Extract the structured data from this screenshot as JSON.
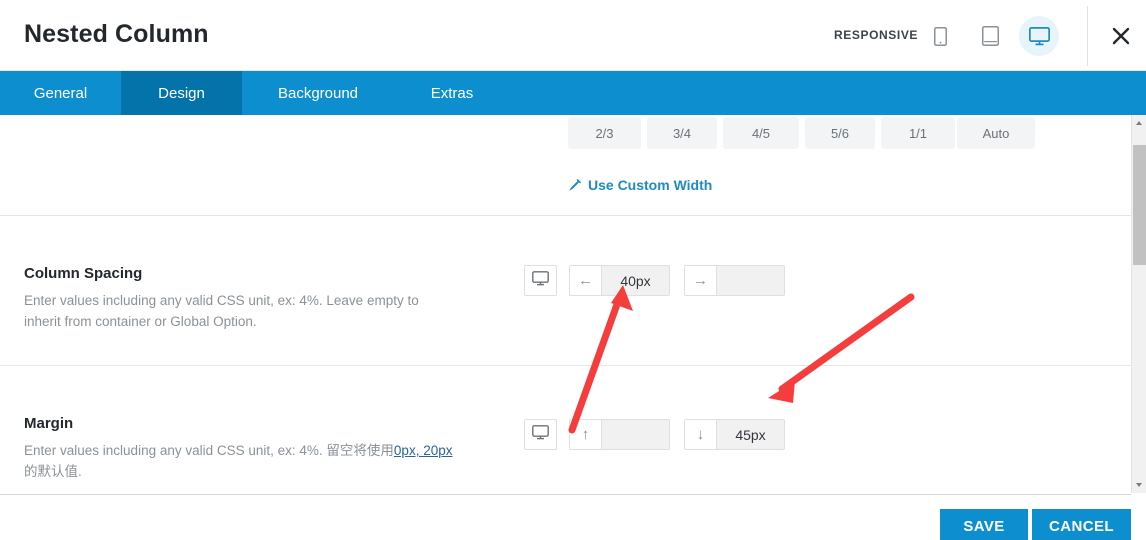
{
  "header": {
    "title": "Nested Column",
    "responsive_label": "RESPONSIVE",
    "devices": [
      {
        "name": "mobile-view-button",
        "icon": "mobile-icon",
        "active": false
      },
      {
        "name": "tablet-view-button",
        "icon": "tablet-icon",
        "active": false
      },
      {
        "name": "desktop-view-button",
        "icon": "desktop-icon",
        "active": true
      }
    ],
    "close_icon": "close-icon"
  },
  "tabs": [
    {
      "label": "General",
      "active": false
    },
    {
      "label": "Design",
      "active": true
    },
    {
      "label": "Background",
      "active": false
    },
    {
      "label": "Extras",
      "active": false
    }
  ],
  "width_presets": [
    {
      "label": "2/3"
    },
    {
      "label": "3/4"
    },
    {
      "label": "4/5"
    },
    {
      "label": "5/6"
    },
    {
      "label": "1/1"
    },
    {
      "label": "Auto"
    }
  ],
  "custom_width": {
    "label": "Use Custom Width",
    "icon": "pencil-icon"
  },
  "sections": [
    {
      "key": "column_spacing",
      "label": "Column Spacing",
      "desc": "Enter values including any valid CSS unit, ex: 4%. Leave empty to inherit from container or Global Option.",
      "device_icon": "desktop-icon",
      "fields": [
        {
          "name": "column-spacing-left-input",
          "prefix_icon": "arrow-left-icon",
          "prefix_glyph": "←",
          "value": "40px",
          "placeholder": ""
        },
        {
          "name": "column-spacing-right-input",
          "prefix_icon": "arrow-right-icon",
          "prefix_glyph": "→",
          "value": "",
          "placeholder": ""
        }
      ]
    },
    {
      "key": "margin",
      "label": "Margin",
      "desc_parts": [
        {
          "text": "Enter values including any valid CSS unit, ex: 4%. 留空将使用",
          "link": false
        },
        {
          "text": "0px, 20px",
          "link": true
        },
        {
          "text": "的默认值.",
          "link": false
        }
      ],
      "device_icon": "desktop-icon",
      "fields": [
        {
          "name": "margin-top-input",
          "prefix_icon": "arrow-up-icon",
          "prefix_glyph": "↑",
          "value": "",
          "placeholder": ""
        },
        {
          "name": "margin-bottom-input",
          "prefix_icon": "arrow-down-icon",
          "prefix_glyph": "↓",
          "value": "45px",
          "placeholder": ""
        }
      ]
    }
  ],
  "footer": {
    "save_label": "SAVE",
    "cancel_label": "CANCEL"
  },
  "colors": {
    "tab_bar": "#0d8ecf",
    "tab_active": "#0373aa",
    "link": "#1e8cbe",
    "annotation": "#f53d3d",
    "button": "#0d8ecf"
  },
  "annotations": [
    {
      "name": "arrow-to-column-spacing-value",
      "color": "#f53d3d"
    },
    {
      "name": "arrow-to-margin-bottom-value",
      "color": "#f53d3d"
    }
  ]
}
